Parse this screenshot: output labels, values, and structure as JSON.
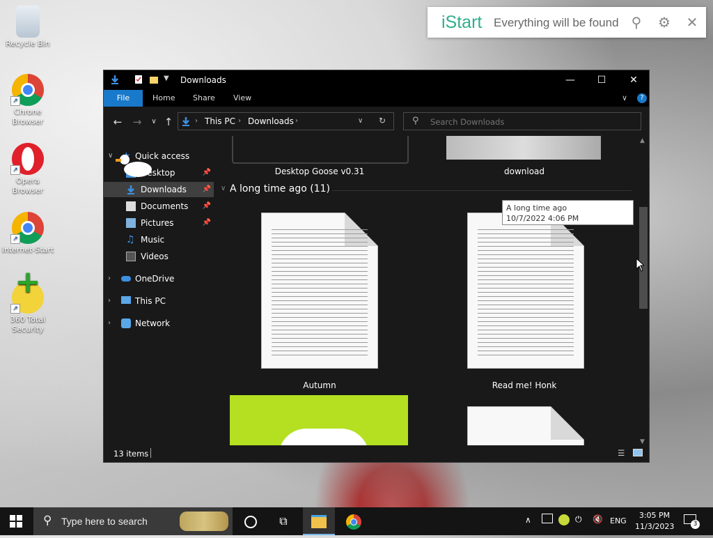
{
  "desktop": {
    "icons": [
      {
        "label": "Recycle Bin"
      },
      {
        "label": "Chrone Browser"
      },
      {
        "label": "Opera Browser"
      },
      {
        "label": "Internet-Start"
      },
      {
        "label": "360 Total Security"
      }
    ]
  },
  "istart": {
    "logo": "iStart",
    "tagline": "Everything will be found"
  },
  "window": {
    "title": "Downloads",
    "ribbon_tabs": [
      "File",
      "Home",
      "Share",
      "View"
    ],
    "address": {
      "crumb1": "This PC",
      "crumb2": "Downloads"
    },
    "search_placeholder": "Search Downloads",
    "status_items": "13 items"
  },
  "sidebar": {
    "quick_access": "Quick access",
    "items": [
      {
        "label": "Desktop"
      },
      {
        "label": "Downloads"
      },
      {
        "label": "Documents"
      },
      {
        "label": "Pictures"
      },
      {
        "label": "Music"
      },
      {
        "label": "Videos"
      }
    ],
    "onedrive": "OneDrive",
    "thispc": "This PC",
    "network": "Network"
  },
  "content": {
    "top_files": [
      {
        "name": "Desktop Goose v0.31"
      },
      {
        "name": "download"
      }
    ],
    "group_header": "A long time ago (11)",
    "files": [
      {
        "name": "Autumn"
      },
      {
        "name": "Read me! Honk"
      }
    ],
    "tooltip": {
      "line1": "A long time ago",
      "line2": "10/7/2022 4:06 PM"
    }
  },
  "taskbar": {
    "search_placeholder": "Type here to search",
    "lang": "ENG",
    "time": "3:05 PM",
    "date": "11/3/2023",
    "notification_count": "3"
  }
}
